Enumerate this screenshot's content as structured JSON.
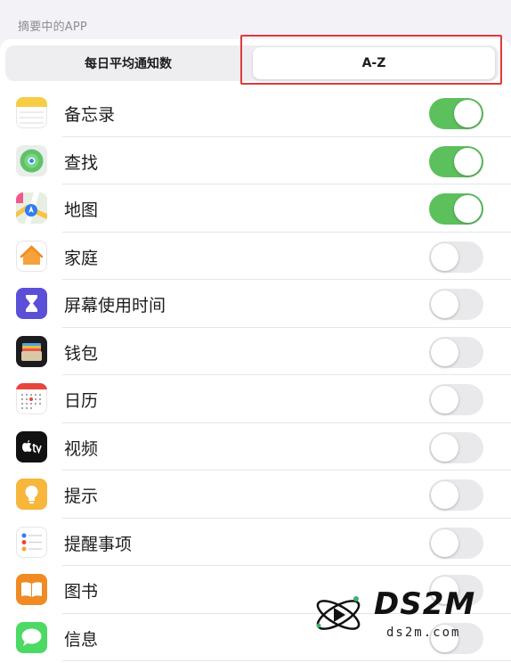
{
  "section_header": "摘要中的APP",
  "segmented": {
    "left_label": "每日平均通知数",
    "right_label": "A-Z",
    "selected": "A-Z"
  },
  "colors": {
    "toggle_on": "#5cc05c",
    "toggle_off": "#e9e9eb",
    "highlight": "#e03a3a"
  },
  "apps": [
    {
      "name": "备忘录",
      "icon": "notes-icon",
      "enabled": true
    },
    {
      "name": "查找",
      "icon": "find-my-icon",
      "enabled": true
    },
    {
      "name": "地图",
      "icon": "maps-icon",
      "enabled": true
    },
    {
      "name": "家庭",
      "icon": "home-icon",
      "enabled": false
    },
    {
      "name": "屏幕使用时间",
      "icon": "screen-time-icon",
      "enabled": false
    },
    {
      "name": "钱包",
      "icon": "wallet-icon",
      "enabled": false
    },
    {
      "name": "日历",
      "icon": "calendar-icon",
      "enabled": false
    },
    {
      "name": "视频",
      "icon": "apple-tv-icon",
      "enabled": false
    },
    {
      "name": "提示",
      "icon": "tips-icon",
      "enabled": false
    },
    {
      "name": "提醒事项",
      "icon": "reminders-icon",
      "enabled": false
    },
    {
      "name": "图书",
      "icon": "books-icon",
      "enabled": false
    },
    {
      "name": "信息",
      "icon": "messages-icon",
      "enabled": false
    }
  ],
  "watermark": {
    "title": "DS2M",
    "subtitle": "ds2m.com"
  }
}
